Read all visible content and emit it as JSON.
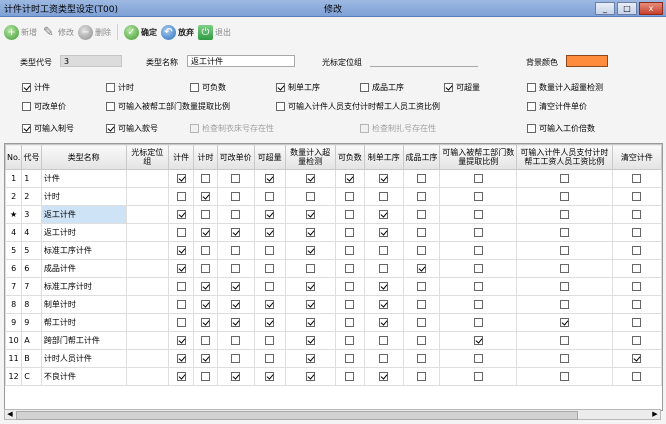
{
  "window": {
    "title": "计件计时工资类型设定(T00)",
    "mode": "修改",
    "controls": [
      "_",
      "□",
      "x"
    ]
  },
  "toolbar": {
    "add": "新增",
    "edit": "修改",
    "delete": "删除",
    "confirm": "确定",
    "abandon": "放弃",
    "exit": "退出"
  },
  "form": {
    "code_label": "类型代号",
    "code_value": "3",
    "name_label": "类型名称",
    "name_value": "返工计件",
    "cursor_group_label": "光标定位组",
    "cursor_group_value": "",
    "bg_color_label": "背景颜色",
    "bg_color": "#ff8c3c"
  },
  "options": [
    {
      "label": "计件",
      "checked": true,
      "disabled": false
    },
    {
      "label": "计时",
      "checked": false,
      "disabled": false
    },
    {
      "label": "可负数",
      "checked": false,
      "disabled": false
    },
    {
      "label": "制单工序",
      "checked": true,
      "disabled": false
    },
    {
      "label": "成品工序",
      "checked": false,
      "disabled": false
    },
    {
      "label": "可超量",
      "checked": true,
      "disabled": false
    },
    {
      "label": "数量计入超量检测",
      "checked": false,
      "disabled": false
    },
    {
      "label": "可改单价",
      "checked": false,
      "disabled": false
    },
    {
      "label": "可输入被帮工部门数量提取比例",
      "checked": false,
      "disabled": false
    },
    {
      "label": "可输入计件人员支付计时帮工人员工资比例",
      "checked": false,
      "disabled": false
    },
    {
      "label": "清空计件单价",
      "checked": false,
      "disabled": false
    },
    {
      "label": "可输入制号",
      "checked": true,
      "disabled": false
    },
    {
      "label": "可输入款号",
      "checked": true,
      "disabled": false
    },
    {
      "label": "检查制衣床号存在性",
      "checked": false,
      "disabled": true
    },
    {
      "label": "检查制扎号存在性",
      "checked": false,
      "disabled": true
    },
    {
      "label": "可输入工价倍数",
      "checked": false,
      "disabled": false
    }
  ],
  "table": {
    "headers": [
      "No.",
      "代号",
      "类型名称",
      "光标定位组",
      "计件",
      "计时",
      "可改单价",
      "可超量",
      "数量计入超量检测",
      "可负数",
      "制单工序",
      "成品工序",
      "可输入被帮工部门数量提取比例",
      "可输入计件人员支付计时帮工工资人员工资比例",
      "清空计件"
    ],
    "current_row_marker": "★",
    "rows": [
      {
        "no": "1",
        "code": "1",
        "name": "计件",
        "group": "",
        "flags": [
          1,
          0,
          0,
          1,
          1,
          1,
          1,
          0,
          0,
          0,
          0
        ]
      },
      {
        "no": "2",
        "code": "2",
        "name": "计时",
        "group": "",
        "flags": [
          0,
          1,
          0,
          0,
          0,
          0,
          0,
          0,
          0,
          0,
          0
        ]
      },
      {
        "no": "3",
        "code": "3",
        "name": "返工计件",
        "group": "",
        "flags": [
          1,
          0,
          0,
          1,
          1,
          0,
          1,
          0,
          0,
          0,
          0
        ]
      },
      {
        "no": "4",
        "code": "4",
        "name": "返工计时",
        "group": "",
        "flags": [
          0,
          1,
          1,
          1,
          1,
          0,
          1,
          0,
          0,
          0,
          0
        ]
      },
      {
        "no": "5",
        "code": "5",
        "name": "标准工序计件",
        "group": "",
        "flags": [
          1,
          0,
          0,
          0,
          1,
          0,
          0,
          0,
          0,
          0,
          0
        ]
      },
      {
        "no": "6",
        "code": "6",
        "name": "成品计件",
        "group": "",
        "flags": [
          1,
          0,
          0,
          0,
          0,
          0,
          0,
          1,
          0,
          0,
          0
        ]
      },
      {
        "no": "7",
        "code": "7",
        "name": "标准工序计时",
        "group": "",
        "flags": [
          0,
          1,
          1,
          0,
          1,
          0,
          1,
          0,
          0,
          0,
          0
        ]
      },
      {
        "no": "8",
        "code": "8",
        "name": "制单计时",
        "group": "",
        "flags": [
          0,
          1,
          1,
          1,
          1,
          0,
          1,
          0,
          0,
          0,
          0
        ]
      },
      {
        "no": "9",
        "code": "9",
        "name": "帮工计时",
        "group": "",
        "flags": [
          0,
          1,
          1,
          1,
          1,
          0,
          1,
          0,
          0,
          1,
          0
        ]
      },
      {
        "no": "10",
        "code": "A",
        "name": "跨部门帮工计件",
        "group": "",
        "flags": [
          1,
          0,
          0,
          0,
          1,
          0,
          0,
          0,
          1,
          0,
          0
        ]
      },
      {
        "no": "11",
        "code": "B",
        "name": "计时人员计件",
        "group": "",
        "flags": [
          1,
          1,
          0,
          0,
          1,
          0,
          0,
          0,
          0,
          0,
          1
        ]
      },
      {
        "no": "12",
        "code": "C",
        "name": "不良计件",
        "group": "",
        "flags": [
          1,
          0,
          1,
          1,
          1,
          0,
          1,
          0,
          0,
          0,
          0
        ]
      }
    ],
    "selected_row": 2
  }
}
